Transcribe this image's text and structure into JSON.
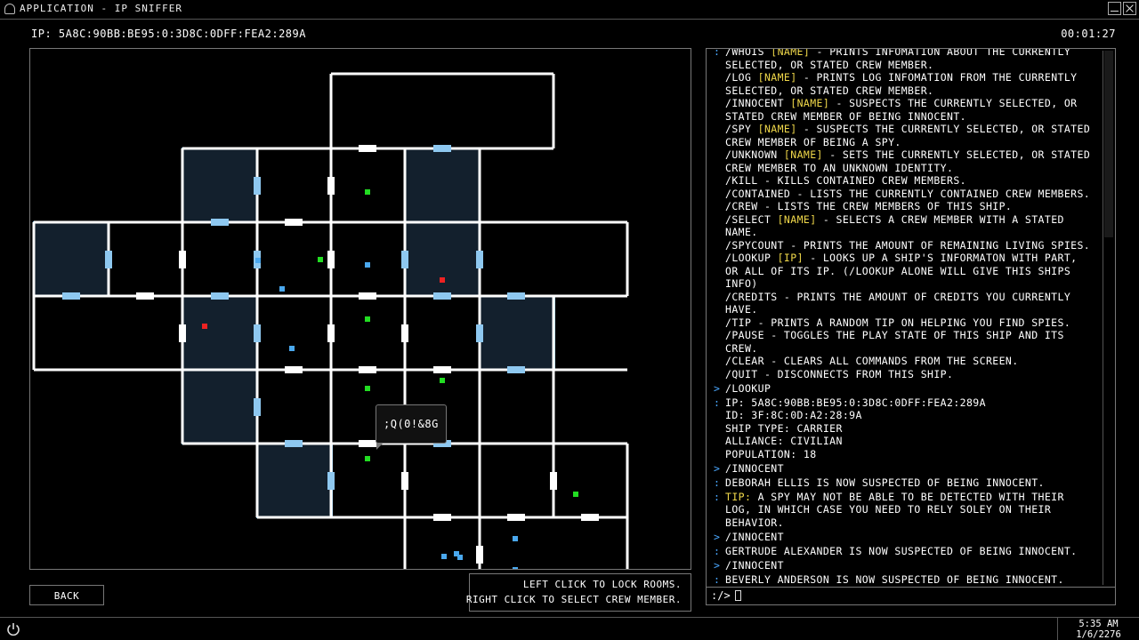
{
  "window": {
    "title": "APPLICATION - IP SNIFFER"
  },
  "header": {
    "ip": "IP: 5A8C:90BB:BE95:0:3D8C:0DFF:FEA2:289A",
    "timer": "00:01:27"
  },
  "map": {
    "tooltip": ";Q(0!&8G",
    "colors": {
      "wall": "#ffffff",
      "room_fill": "#13202d",
      "room_border": "#8ec8f0",
      "crew_blue": "#4aa8ee",
      "crew_green": "#22dd22",
      "crew_red": "#ee2222"
    }
  },
  "controls": {
    "back_label": "BACK",
    "pause_icon": "pause-icon"
  },
  "hints": {
    "line1": "LEFT CLICK TO LOCK ROOMS.",
    "line2": "RIGHT CLICK TO SELECT CREW MEMBER."
  },
  "console": {
    "lines": [
      {
        "mark": ":",
        "parts": [
          {
            "t": "/WHOIS "
          },
          {
            "t": "[NAME]",
            "hl": true
          },
          {
            "t": " - PRINTS INFOMATION ABOUT THE CURRENTLY"
          }
        ]
      },
      {
        "mark": "",
        "parts": [
          {
            "t": "SELECTED, OR STATED CREW MEMBER."
          }
        ]
      },
      {
        "mark": "",
        "parts": [
          {
            "t": "/LOG "
          },
          {
            "t": "[NAME]",
            "hl": true
          },
          {
            "t": " - PRINTS LOG INFOMATION FROM THE CURRENTLY"
          }
        ]
      },
      {
        "mark": "",
        "parts": [
          {
            "t": "SELECTED, OR STATED CREW MEMBER."
          }
        ]
      },
      {
        "mark": "",
        "parts": [
          {
            "t": "/INNOCENT "
          },
          {
            "t": "[NAME]",
            "hl": true
          },
          {
            "t": " - SUSPECTS THE CURRENTLY SELECTED, OR"
          }
        ]
      },
      {
        "mark": "",
        "parts": [
          {
            "t": "STATED CREW MEMBER OF BEING INNOCENT."
          }
        ]
      },
      {
        "mark": "",
        "parts": [
          {
            "t": "/SPY "
          },
          {
            "t": "[NAME]",
            "hl": true
          },
          {
            "t": " - SUSPECTS THE CURRENTLY SELECTED, OR STATED"
          }
        ]
      },
      {
        "mark": "",
        "parts": [
          {
            "t": "CREW MEMBER OF BEING A SPY."
          }
        ]
      },
      {
        "mark": "",
        "parts": [
          {
            "t": "/UNKNOWN "
          },
          {
            "t": "[NAME]",
            "hl": true
          },
          {
            "t": " - SETS THE CURRENTLY SELECTED, OR STATED"
          }
        ]
      },
      {
        "mark": "",
        "parts": [
          {
            "t": "CREW MEMBER TO AN UNKNOWN IDENTITY."
          }
        ]
      },
      {
        "mark": "",
        "parts": [
          {
            "t": "/KILL - KILLS CONTAINED CREW MEMBERS."
          }
        ]
      },
      {
        "mark": "",
        "parts": [
          {
            "t": "/CONTAINED - LISTS THE CURRENTLY CONTAINED CREW MEMBERS."
          }
        ]
      },
      {
        "mark": "",
        "parts": [
          {
            "t": "/CREW - LISTS THE CREW MEMBERS OF THIS SHIP."
          }
        ]
      },
      {
        "mark": "",
        "parts": [
          {
            "t": "/SELECT "
          },
          {
            "t": "[NAME]",
            "hl": true
          },
          {
            "t": " - SELECTS A CREW MEMBER WITH A STATED"
          }
        ]
      },
      {
        "mark": "",
        "parts": [
          {
            "t": "NAME."
          }
        ]
      },
      {
        "mark": "",
        "parts": [
          {
            "t": "/SPYCOUNT - PRINTS THE AMOUNT OF REMAINING LIVING SPIES."
          }
        ]
      },
      {
        "mark": "",
        "parts": [
          {
            "t": "/LOOKUP "
          },
          {
            "t": "[IP]",
            "hl": true
          },
          {
            "t": " - LOOKS UP A SHIP'S INFORMATON WITH PART,"
          }
        ]
      },
      {
        "mark": "",
        "parts": [
          {
            "t": "OR ALL OF ITS IP. (/LOOKUP ALONE WILL GIVE THIS SHIPS"
          }
        ]
      },
      {
        "mark": "",
        "parts": [
          {
            "t": "INFO)"
          }
        ]
      },
      {
        "mark": "",
        "parts": [
          {
            "t": "/CREDITS - PRINTS THE AMOUNT OF CREDITS YOU CURRENTLY"
          }
        ]
      },
      {
        "mark": "",
        "parts": [
          {
            "t": "HAVE."
          }
        ]
      },
      {
        "mark": "",
        "parts": [
          {
            "t": "/TIP - PRINTS A RANDOM TIP ON HELPING YOU FIND SPIES."
          }
        ]
      },
      {
        "mark": "",
        "parts": [
          {
            "t": "/PAUSE - TOGGLES THE PLAY STATE OF THIS SHIP AND ITS"
          }
        ]
      },
      {
        "mark": "",
        "parts": [
          {
            "t": "CREW."
          }
        ]
      },
      {
        "mark": "",
        "parts": [
          {
            "t": "/CLEAR - CLEARS ALL COMMANDS FROM THE SCREEN."
          }
        ]
      },
      {
        "mark": "",
        "parts": [
          {
            "t": "/QUIT - DISCONNECTS FROM THIS SHIP."
          }
        ]
      },
      {
        "mark": ">",
        "gap": true,
        "parts": [
          {
            "t": "/LOOKUP"
          }
        ]
      },
      {
        "mark": ":",
        "gap": true,
        "parts": [
          {
            "t": "IP: 5A8C:90BB:BE95:0:3D8C:0DFF:FEA2:289A"
          }
        ]
      },
      {
        "mark": "",
        "parts": [
          {
            "t": "ID: 3F:8C:0D:A2:28:9A"
          }
        ]
      },
      {
        "mark": "",
        "parts": [
          {
            "t": "SHIP TYPE: CARRIER"
          }
        ]
      },
      {
        "mark": "",
        "parts": [
          {
            "t": "ALLIANCE: CIVILIAN"
          }
        ]
      },
      {
        "mark": "",
        "parts": [
          {
            "t": "POPULATION: 18"
          }
        ]
      },
      {
        "mark": ">",
        "gap": true,
        "parts": [
          {
            "t": "/INNOCENT"
          }
        ]
      },
      {
        "mark": ":",
        "gap": true,
        "parts": [
          {
            "t": "DEBORAH ELLIS IS NOW SUSPECTED OF BEING INNOCENT."
          }
        ]
      },
      {
        "mark": ":",
        "gap": true,
        "parts": [
          {
            "t": "TIP:",
            "hl": true
          },
          {
            "t": " A SPY MAY NOT BE ABLE TO BE DETECTED WITH THEIR"
          }
        ]
      },
      {
        "mark": "",
        "parts": [
          {
            "t": "LOG, IN WHICH CASE YOU NEED TO RELY SOLEY ON THEIR"
          }
        ]
      },
      {
        "mark": "",
        "parts": [
          {
            "t": "BEHAVIOR."
          }
        ]
      },
      {
        "mark": ">",
        "gap": true,
        "parts": [
          {
            "t": "/INNOCENT"
          }
        ]
      },
      {
        "mark": ":",
        "gap": true,
        "parts": [
          {
            "t": "GERTRUDE ALEXANDER IS NOW SUSPECTED OF BEING INNOCENT."
          }
        ]
      },
      {
        "mark": ">",
        "gap": true,
        "parts": [
          {
            "t": "/INNOCENT"
          }
        ]
      },
      {
        "mark": ":",
        "gap": true,
        "parts": [
          {
            "t": "BEVERLY ANDERSON IS NOW SUSPECTED OF BEING INNOCENT."
          }
        ]
      }
    ]
  },
  "command": {
    "prompt": ":/>",
    "value": ""
  },
  "taskbar": {
    "time": "5:35 AM",
    "date": "1/6/2276",
    "power_icon": "power-icon"
  }
}
